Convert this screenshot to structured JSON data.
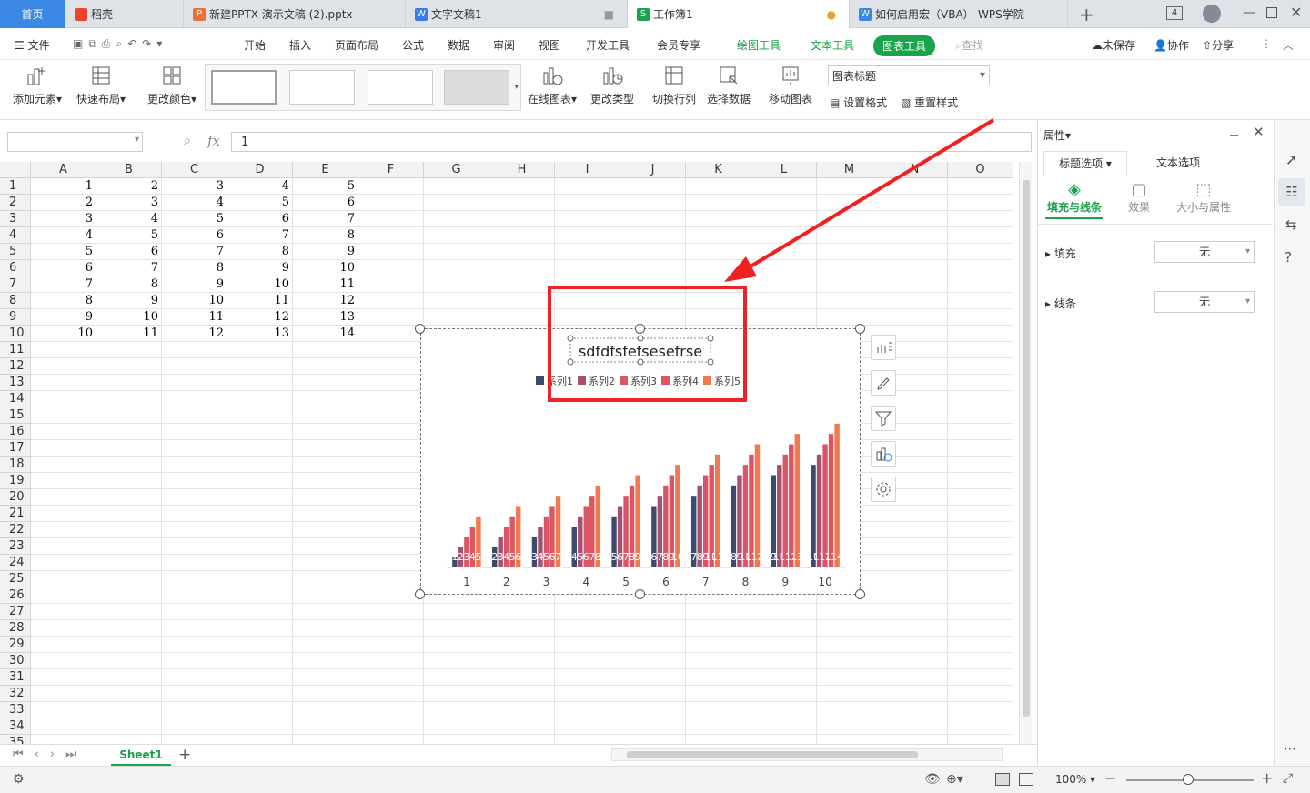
{
  "tabs": [
    {
      "label": "首页"
    },
    {
      "label": "稻壳"
    },
    {
      "label": "新建PPTX 演示文稿 (2).pptx"
    },
    {
      "label": "文字文稿1"
    },
    {
      "label": "工作簿1"
    },
    {
      "label": "如何启用宏（VBA）-WPS学院"
    }
  ],
  "tab_extra": {
    "plus": "+",
    "count": "4"
  },
  "menu": {
    "file": "文件",
    "items": [
      "开始",
      "插入",
      "页面布局",
      "公式",
      "数据",
      "审阅",
      "视图",
      "开发工具",
      "会员专享"
    ],
    "tool_tabs": [
      "绘图工具",
      "文本工具"
    ],
    "active_tool": "图表工具",
    "search": "查找",
    "right": [
      "未保存",
      "协作",
      "分享"
    ]
  },
  "ribbon": {
    "add_element": "添加元素",
    "quick_layout": "快速布局",
    "change_color": "更改颜色",
    "online_chart": "在线图表",
    "change_type": "更改类型",
    "switch_rowcol": "切换行列",
    "select_data": "选择数据",
    "move_chart": "移动图表",
    "element_select": "图表标题",
    "set_format": "设置格式",
    "reset_style": "重置样式"
  },
  "formula": {
    "fx": "fx",
    "value": "1"
  },
  "columns": [
    "A",
    "B",
    "C",
    "D",
    "E",
    "F",
    "G",
    "H",
    "I",
    "J",
    "K",
    "L",
    "M",
    "N",
    "O"
  ],
  "row_count": 35,
  "cells": [
    [
      1,
      2,
      3,
      4,
      5
    ],
    [
      2,
      3,
      4,
      5,
      6
    ],
    [
      3,
      4,
      5,
      6,
      7
    ],
    [
      4,
      5,
      6,
      7,
      8
    ],
    [
      5,
      6,
      7,
      8,
      9
    ],
    [
      6,
      7,
      8,
      9,
      10
    ],
    [
      7,
      8,
      9,
      10,
      11
    ],
    [
      8,
      9,
      10,
      11,
      12
    ],
    [
      9,
      10,
      11,
      12,
      13
    ],
    [
      10,
      11,
      12,
      13,
      14
    ]
  ],
  "chart_data": {
    "type": "bar",
    "title": "sdfdfsfefsesefrse",
    "categories": [
      "1",
      "2",
      "3",
      "4",
      "5",
      "6",
      "7",
      "8",
      "9",
      "10"
    ],
    "series": [
      {
        "name": "系列1",
        "values": [
          1,
          2,
          3,
          4,
          5,
          6,
          7,
          8,
          9,
          10
        ]
      },
      {
        "name": "系列2",
        "values": [
          2,
          3,
          4,
          5,
          6,
          7,
          8,
          9,
          10,
          11
        ]
      },
      {
        "name": "系列3",
        "values": [
          3,
          4,
          5,
          6,
          7,
          8,
          9,
          10,
          11,
          12
        ]
      },
      {
        "name": "系列4",
        "values": [
          4,
          5,
          6,
          7,
          8,
          9,
          10,
          11,
          12,
          13
        ]
      },
      {
        "name": "系列5",
        "values": [
          5,
          6,
          7,
          8,
          9,
          10,
          11,
          12,
          13,
          14
        ]
      }
    ],
    "colors": [
      "#3d4a6b",
      "#a8506f",
      "#d9566a",
      "#e0545f",
      "#f07a50"
    ],
    "ylim": [
      0,
      15
    ],
    "legend": "top",
    "data_labels": true
  },
  "sheet": {
    "name": "Sheet1"
  },
  "status": {
    "zoom": "100%"
  },
  "panel": {
    "title": "属性",
    "tabs": [
      "标题选项",
      "文本选项"
    ],
    "subtabs": [
      "填充与线条",
      "效果",
      "大小与属性"
    ],
    "fill_label": "填充",
    "fill_value": "无",
    "line_label": "线条",
    "line_value": "无"
  }
}
